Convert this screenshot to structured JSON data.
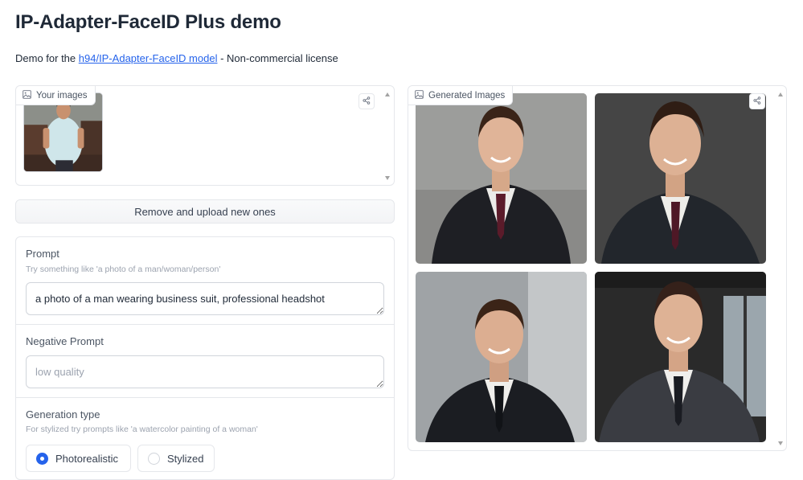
{
  "header": {
    "title": "IP-Adapter-FaceID Plus demo",
    "description_prefix": "Demo for the ",
    "model_link": "h94/IP-Adapter-FaceID model",
    "description_suffix": " - Non-commercial license"
  },
  "input_gallery": {
    "label": "Your images",
    "icon": "image-icon",
    "share_icon": "share-icon"
  },
  "remove_button": {
    "label": "Remove and upload new ones"
  },
  "prompt": {
    "label": "Prompt",
    "info": "Try something like 'a photo of a man/woman/person'",
    "value": "a photo of a man wearing business suit, professional headshot"
  },
  "negative_prompt": {
    "label": "Negative Prompt",
    "placeholder": "low quality"
  },
  "generation_type": {
    "label": "Generation type",
    "info": "For stylized try prompts like 'a watercolor painting of a woman'",
    "options": [
      "Photorealistic",
      "Stylized"
    ],
    "selected": "Photorealistic"
  },
  "output_gallery": {
    "label": "Generated Images",
    "icon": "image-icon",
    "share_icon": "share-icon"
  },
  "colors": {
    "accent": "#2563eb",
    "border": "#e5e7eb",
    "text": "#1f2937",
    "muted": "#9ca3af"
  }
}
